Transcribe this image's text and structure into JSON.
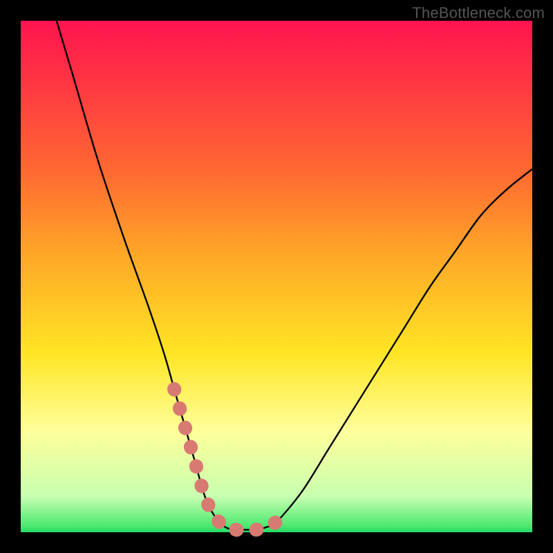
{
  "watermark": "TheBottleneck.com",
  "colors": {
    "top": "#ff1450",
    "red": "#ff2a46",
    "redorange": "#ff6a32",
    "orange": "#ffa528",
    "yellow": "#ffe524",
    "paleyellow": "#ffff9a",
    "palegreen": "#c8ffb0",
    "green": "#47e86e",
    "green2": "#20d868",
    "curve": "#000000",
    "marker": "#d87a72"
  },
  "chart_data": {
    "type": "line",
    "title": "",
    "xlabel": "",
    "ylabel": "",
    "xlim": [
      0,
      100
    ],
    "ylim": [
      0,
      100
    ],
    "series": [
      {
        "name": "bottleneck-curve",
        "x": [
          7,
          10,
          15,
          20,
          25,
          28,
          30,
          32,
          34,
          36,
          38,
          40,
          42,
          44,
          46,
          48,
          50,
          55,
          60,
          65,
          70,
          75,
          80,
          85,
          90,
          95,
          100
        ],
        "values": [
          100,
          90,
          73,
          58,
          44,
          35,
          28,
          21,
          14,
          7,
          3,
          1,
          0.5,
          0.5,
          0.5,
          1,
          2,
          8,
          16,
          24,
          32,
          40,
          48,
          55,
          62,
          67,
          71
        ]
      }
    ],
    "markers": {
      "name": "highlight-band",
      "x": [
        30,
        32,
        34,
        36,
        38,
        40,
        42,
        44,
        46,
        48,
        50
      ],
      "values": [
        28,
        21,
        14,
        7,
        3,
        1,
        0.5,
        0.5,
        0.5,
        1,
        2
      ]
    }
  }
}
